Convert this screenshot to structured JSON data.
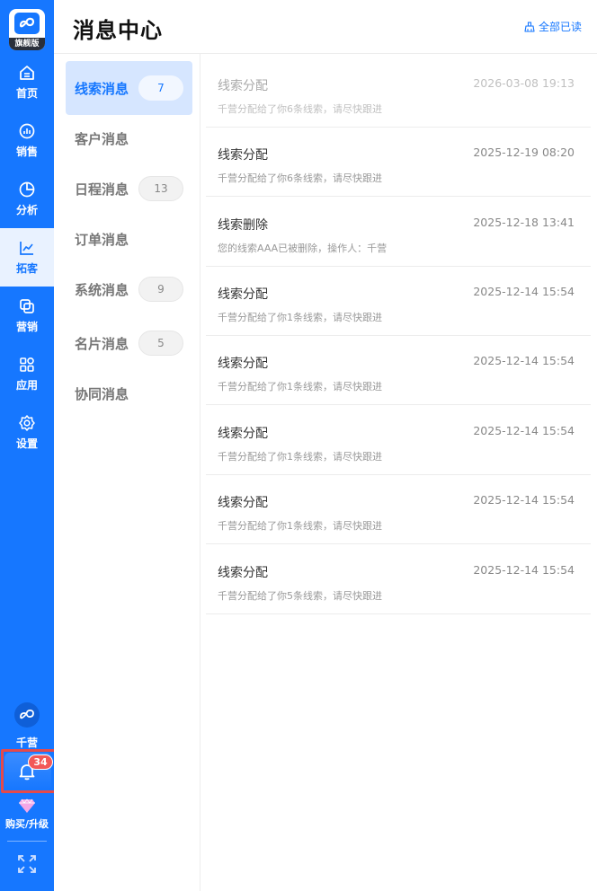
{
  "app": {
    "logo_tag": "旗舰版",
    "accent_color": "#1677ff"
  },
  "nav": {
    "items": [
      {
        "label": "首页",
        "icon": "home-icon"
      },
      {
        "label": "销售",
        "icon": "sales-chart-icon"
      },
      {
        "label": "分析",
        "icon": "pie-chart-icon"
      },
      {
        "label": "拓客",
        "icon": "trend-line-icon",
        "active": true
      },
      {
        "label": "营销",
        "icon": "marketing-icon"
      },
      {
        "label": "应用",
        "icon": "apps-grid-icon"
      },
      {
        "label": "设置",
        "icon": "gear-icon"
      }
    ],
    "user_name": "千营",
    "notification_count": "34",
    "upgrade_label": "购买/升级"
  },
  "header": {
    "title": "消息中心",
    "mark_all_read": "全部已读"
  },
  "categories": [
    {
      "label": "线索消息",
      "count": "7",
      "active": true
    },
    {
      "label": "客户消息",
      "count": ""
    },
    {
      "label": "日程消息",
      "count": "13"
    },
    {
      "label": "订单消息",
      "count": ""
    },
    {
      "label": "系统消息",
      "count": "9"
    },
    {
      "label": "名片消息",
      "count": "5"
    },
    {
      "label": "协同消息",
      "count": ""
    }
  ],
  "messages": [
    {
      "title": "线索分配",
      "date": "2026-03-08 19:13",
      "summary": "千营分配给了你6条线索，请尽快跟进",
      "read": true
    },
    {
      "title": "线索分配",
      "date": "2025-12-19 08:20",
      "summary": "千营分配给了你6条线索，请尽快跟进"
    },
    {
      "title": "线索删除",
      "date": "2025-12-18 13:41",
      "summary": "您的线索AAA已被删除，操作人：千营"
    },
    {
      "title": "线索分配",
      "date": "2025-12-14 15:54",
      "summary": "千营分配给了你1条线索，请尽快跟进"
    },
    {
      "title": "线索分配",
      "date": "2025-12-14 15:54",
      "summary": "千营分配给了你1条线索，请尽快跟进"
    },
    {
      "title": "线索分配",
      "date": "2025-12-14 15:54",
      "summary": "千营分配给了你1条线索，请尽快跟进"
    },
    {
      "title": "线索分配",
      "date": "2025-12-14 15:54",
      "summary": "千营分配给了你1条线索，请尽快跟进"
    },
    {
      "title": "线索分配",
      "date": "2025-12-14 15:54",
      "summary": "千营分配给了你5条线索，请尽快跟进"
    }
  ]
}
